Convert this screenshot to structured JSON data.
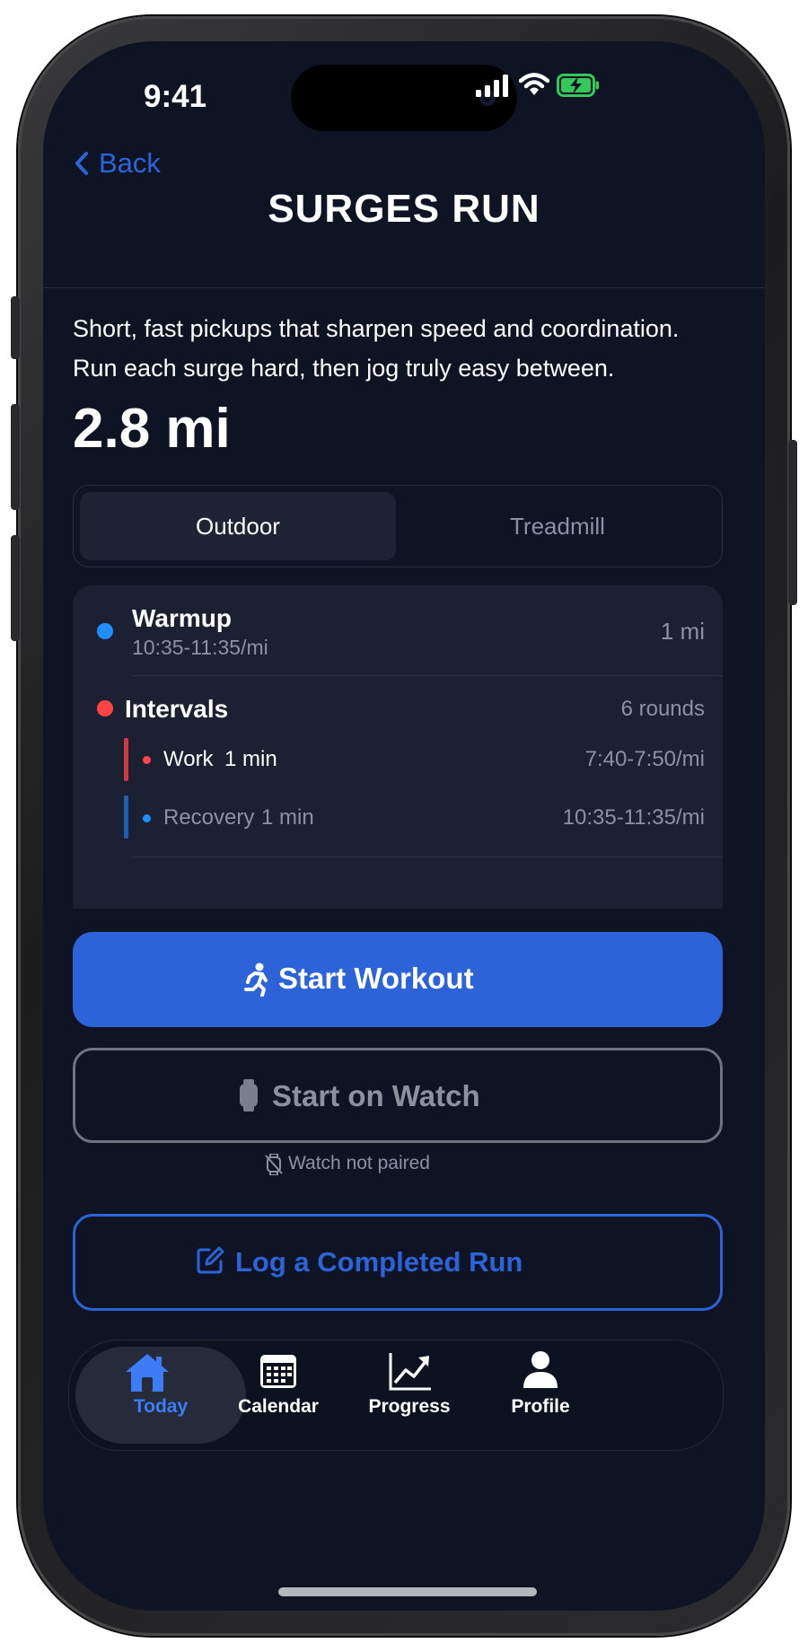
{
  "status_bar": {
    "time": "9:41"
  },
  "nav": {
    "back_label": "Back",
    "title": "SURGES RUN"
  },
  "description": "Short, fast pickups that sharpen speed and coordination. Run each surge hard, then jog truly easy between.",
  "distance": "2.8 mi",
  "segment": {
    "options": [
      "Outdoor",
      "Treadmill"
    ],
    "selected": "Outdoor"
  },
  "plan": {
    "warmup": {
      "name": "Warmup",
      "pace": "10:35-11:35/mi",
      "distance": "1 mi"
    },
    "intervals": {
      "name": "Intervals",
      "rounds": "6 rounds",
      "work": {
        "name": "Work",
        "duration": "1 min",
        "pace": "7:40-7:50/mi"
      },
      "recovery": {
        "name": "Recovery",
        "duration": "1 min",
        "pace": "10:35-11:35/mi"
      }
    }
  },
  "actions": {
    "start_workout": "Start Workout",
    "start_on_watch": "Start on Watch",
    "watch_status": "Watch not paired",
    "log_run": "Log a Completed Run"
  },
  "tabbar": {
    "items": [
      {
        "label": "Today",
        "icon": "house-icon",
        "selected": true
      },
      {
        "label": "Calendar",
        "icon": "calendar-icon",
        "selected": false
      },
      {
        "label": "Progress",
        "icon": "chart-icon",
        "selected": false
      },
      {
        "label": "Profile",
        "icon": "person-icon",
        "selected": false
      }
    ]
  },
  "colors": {
    "background": "#0f1424",
    "accent": "#2d63d9",
    "warmup_dot": "#1f8fff",
    "intervals_dot": "#ff4444",
    "battery_green": "#34c759"
  }
}
